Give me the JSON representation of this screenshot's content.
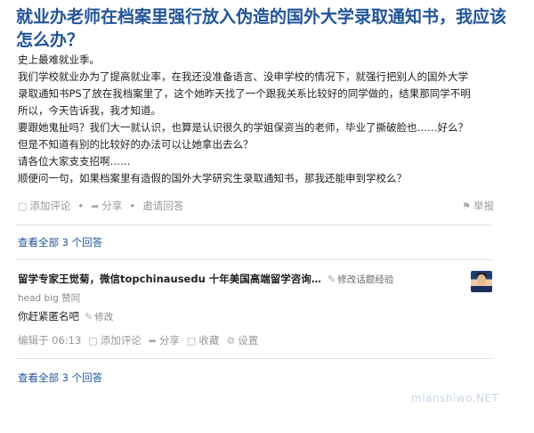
{
  "question": {
    "title": "就业办老师在档案里强行放入伪造的国外大学录取通知书，我应该怎么办？",
    "body": [
      "史上最难就业季。",
      "我们学校就业办为了提高就业率，在我还没准备语言、没申学校的情况下，就强行把别人的国外大学",
      "录取通知书PS了放在我档案里了，这个她昨天找了一个跟我关系比较好的同学做的，结果那同学不明",
      "所以，今天告诉我，我才知道。",
      "要跟她鬼扯吗？我们大一就认识，也算是认识很久的学姐保资当的老师，毕业了撕破脸也……好么？",
      "但是不知道有别的比较好的办法可以让她拿出去么？",
      "请各位大家支支招啊……",
      "顺便问一句，如果档案里有造假的国外大学研究生录取通知书，那我还能申到学校么？"
    ],
    "actions": {
      "add_comment": "添加评论",
      "share": "分享",
      "invite": "邀请回答",
      "report": "举报"
    },
    "view_all_answers": "查看全部 3 个回答"
  },
  "answer": {
    "author": "留学专家王觉菊，微信topchinausedu 十年美国高端留学咨询…",
    "edit_signature": "修改话题经验",
    "voters": "head big 赞同",
    "content": "你赶紧匿名吧",
    "edit_label": "修改",
    "footer": {
      "edited_at": "编辑于 06:13",
      "add_comment": "添加评论",
      "share": "分享",
      "collect": "收藏",
      "settings": "设置"
    }
  },
  "bottom_view_all_answers": "查看全部 3 个回答",
  "watermark": "mianshiwo.NET",
  "icons": {
    "comment": "comment-icon",
    "share": "share-icon",
    "report": "flag-icon",
    "edit": "pencil-icon",
    "collect": "bookmark-icon",
    "settings": "gear-icon"
  },
  "colors": {
    "title": "#225599",
    "link": "#225599",
    "muted": "#999999"
  }
}
